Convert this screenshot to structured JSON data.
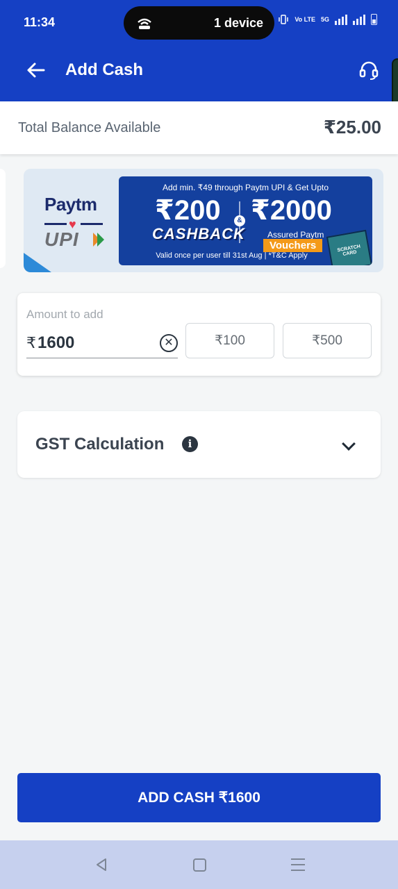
{
  "status_bar": {
    "time": "11:34",
    "hotspot_text": "1 device",
    "volte": "Vo LTE",
    "network": "5G"
  },
  "app_bar": {
    "title": "Add Cash"
  },
  "balance": {
    "label": "Total Balance Available",
    "value": "₹25.00"
  },
  "banner": {
    "brand": "Paytm",
    "upi": "UPI",
    "top_text": "Add min. ₹49 through Paytm UPI & Get Upto",
    "cashback_amount": "₹200",
    "cashback_label": "CASHBACK",
    "amp": "&",
    "voucher_amount": "₹2000",
    "voucher_caption": "Assured Paytm",
    "voucher_label": "Vouchers",
    "validity": "Valid once per user till 31st Aug | *T&C Apply",
    "scratch_label": "SCRATCH CARD"
  },
  "amount": {
    "label": "Amount to add",
    "currency": "₹",
    "value": "1600",
    "chips": [
      "₹100",
      "₹500"
    ]
  },
  "gst": {
    "title": "GST Calculation",
    "info": "i"
  },
  "cta": {
    "label": "ADD CASH ₹1600"
  }
}
